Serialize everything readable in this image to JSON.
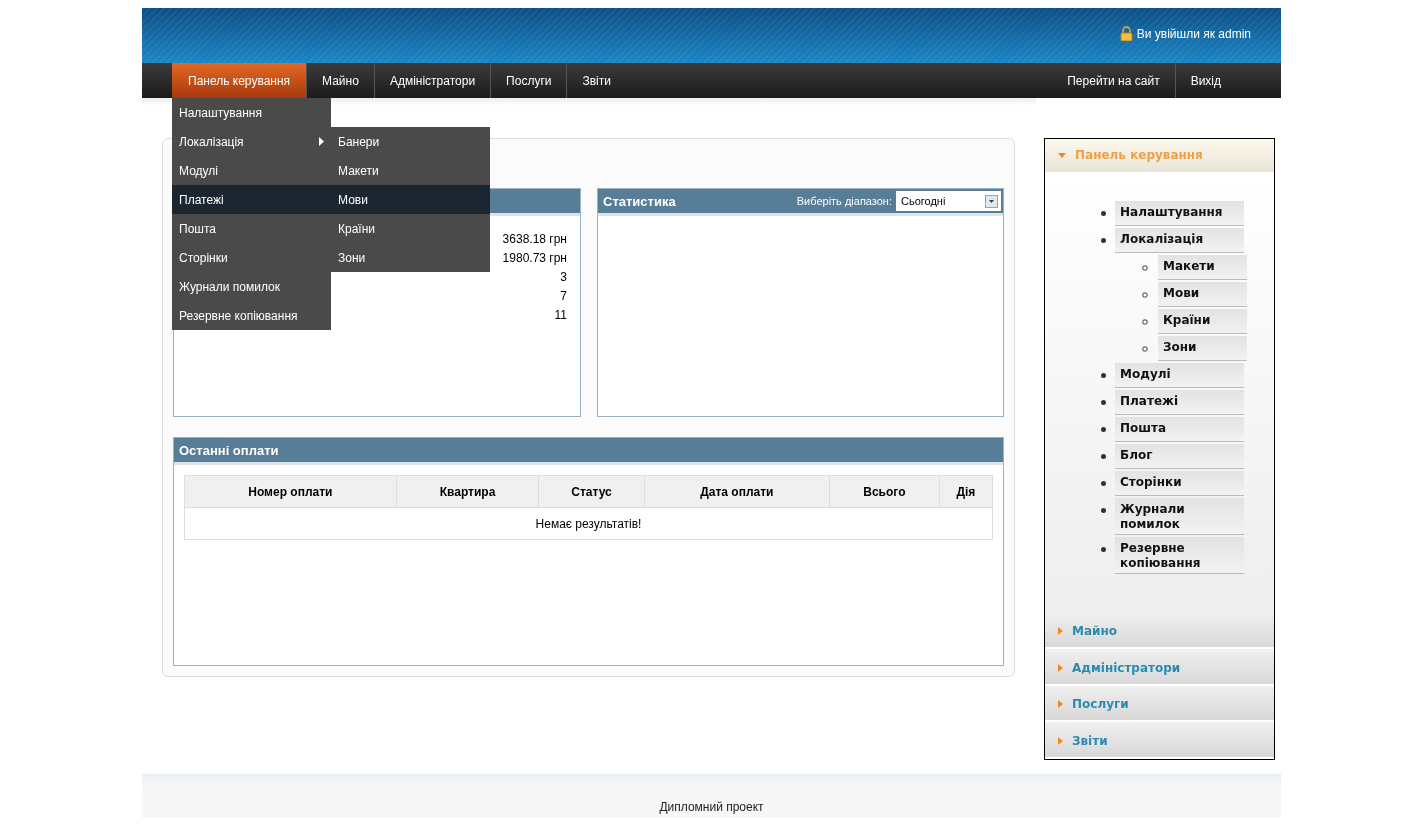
{
  "header": {
    "login_text": "Ви увійшли як admin"
  },
  "nav": {
    "tabs": [
      {
        "label": "Панель керування",
        "selected": true
      },
      {
        "label": "Майно",
        "selected": false
      },
      {
        "label": "Адміністратори",
        "selected": false
      },
      {
        "label": "Послуги",
        "selected": false
      },
      {
        "label": "Звіти",
        "selected": false
      }
    ],
    "right_links": [
      "Перейти на сайт",
      "Вихід"
    ]
  },
  "dropdown": {
    "items": [
      {
        "label": "Налаштування",
        "selected": false
      },
      {
        "label": "Локалізація",
        "selected": false,
        "children": [
          {
            "label": "Банери",
            "selected": false
          },
          {
            "label": "Макети",
            "selected": false
          },
          {
            "label": "Мови",
            "selected": true
          },
          {
            "label": "Країни",
            "selected": false
          },
          {
            "label": "Зони",
            "selected": false
          }
        ]
      },
      {
        "label": "Модулі",
        "selected": false
      },
      {
        "label": "Платежі",
        "selected": true
      },
      {
        "label": "Пошта",
        "selected": false
      },
      {
        "label": "Сторінки",
        "selected": false
      },
      {
        "label": "Журнали помилок",
        "selected": false
      },
      {
        "label": "Резервне копіювання",
        "selected": false
      }
    ]
  },
  "summary": {
    "values": [
      "3638.18 грн",
      "1980.73 грн",
      "3",
      "7",
      "11"
    ]
  },
  "statistics": {
    "title": "Статистика",
    "range_label": "Виберіть діапазон:",
    "range_value": "Сьогодні"
  },
  "recent_payments": {
    "title": "Останні оплати",
    "columns": [
      "Номер оплати",
      "Квартира",
      "Статус",
      "Дата оплати",
      "Всього",
      "Дія"
    ],
    "empty_text": "Немає результатів!"
  },
  "sidebar": {
    "sections": [
      {
        "title": "Панель керування",
        "expanded": true,
        "items": [
          {
            "label": "Налаштування"
          },
          {
            "label": "Локалізація",
            "children": [
              {
                "label": "Макети"
              },
              {
                "label": "Мови"
              },
              {
                "label": "Країни"
              },
              {
                "label": "Зони"
              }
            ]
          },
          {
            "label": "Модулі"
          },
          {
            "label": "Платежі"
          },
          {
            "label": "Пошта"
          },
          {
            "label": "Блог"
          },
          {
            "label": "Сторінки"
          },
          {
            "label": "Журнали помилок"
          },
          {
            "label": "Резервне копіювання"
          }
        ]
      },
      {
        "title": "Майно",
        "expanded": false
      },
      {
        "title": "Адміністратори",
        "expanded": false
      },
      {
        "title": "Послуги",
        "expanded": false
      },
      {
        "title": "Звіти",
        "expanded": false
      }
    ]
  },
  "footer": {
    "text": "Дипломний проект"
  }
}
